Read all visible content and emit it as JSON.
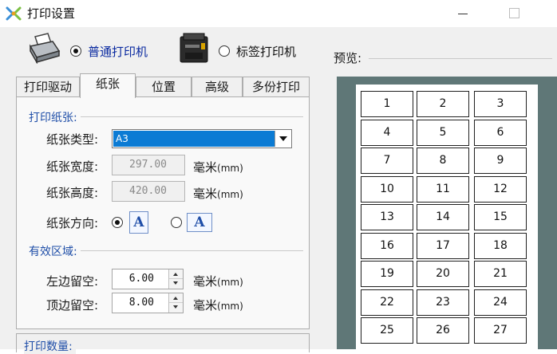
{
  "window": {
    "title": "打印设置"
  },
  "printer_type": {
    "normal_label": "普通打印机",
    "label_label": "标签打印机",
    "selected": "normal"
  },
  "tabs": [
    {
      "label": "打印驱动"
    },
    {
      "label": "纸张",
      "active": true
    },
    {
      "label": "位置"
    },
    {
      "label": "高级"
    },
    {
      "label": "多份打印"
    }
  ],
  "paper_group": {
    "title": "打印纸张:",
    "type_label": "纸张类型:",
    "type_value": "A3",
    "width_label": "纸张宽度:",
    "width_value": "297.00",
    "height_label": "纸张高度:",
    "height_value": "420.00",
    "unit_main": "毫米",
    "unit_abbr": "(mm)",
    "orientation_label": "纸张方向:",
    "orientation_icon_text": "A",
    "orientation_selected": "portrait"
  },
  "margin_group": {
    "title": "有效区域:",
    "left_label": "左边留空:",
    "left_value": "6.00",
    "top_label": "顶边留空:",
    "top_value": "8.00"
  },
  "bottom_group": {
    "title": "打印数量:"
  },
  "preview": {
    "label": "预览:",
    "cells": [
      "1",
      "2",
      "3",
      "4",
      "5",
      "6",
      "7",
      "8",
      "9",
      "10",
      "11",
      "12",
      "13",
      "14",
      "15",
      "16",
      "17",
      "18",
      "19",
      "20",
      "21",
      "22",
      "23",
      "24",
      "25",
      "26",
      "27"
    ]
  },
  "colors": {
    "accent_blue": "#1f4ea8",
    "selection_blue": "#0b7bd4",
    "preview_bg": "#5f7777"
  }
}
